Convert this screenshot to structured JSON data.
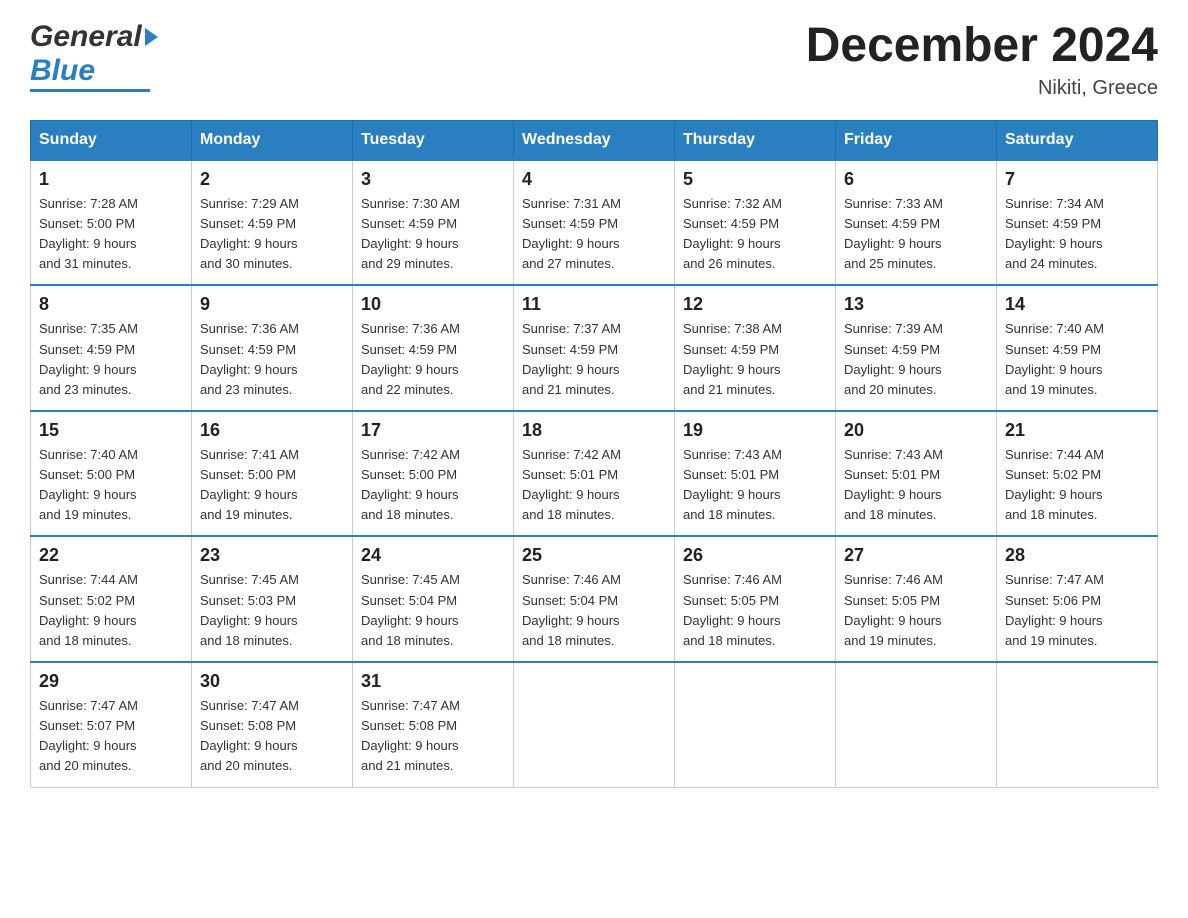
{
  "header": {
    "logo_general": "General",
    "logo_blue": "Blue",
    "month_title": "December 2024",
    "location": "Nikiti, Greece"
  },
  "days_of_week": [
    "Sunday",
    "Monday",
    "Tuesday",
    "Wednesday",
    "Thursday",
    "Friday",
    "Saturday"
  ],
  "weeks": [
    [
      {
        "day": "1",
        "sunrise": "7:28 AM",
        "sunset": "5:00 PM",
        "daylight": "9 hours and 31 minutes."
      },
      {
        "day": "2",
        "sunrise": "7:29 AM",
        "sunset": "4:59 PM",
        "daylight": "9 hours and 30 minutes."
      },
      {
        "day": "3",
        "sunrise": "7:30 AM",
        "sunset": "4:59 PM",
        "daylight": "9 hours and 29 minutes."
      },
      {
        "day": "4",
        "sunrise": "7:31 AM",
        "sunset": "4:59 PM",
        "daylight": "9 hours and 27 minutes."
      },
      {
        "day": "5",
        "sunrise": "7:32 AM",
        "sunset": "4:59 PM",
        "daylight": "9 hours and 26 minutes."
      },
      {
        "day": "6",
        "sunrise": "7:33 AM",
        "sunset": "4:59 PM",
        "daylight": "9 hours and 25 minutes."
      },
      {
        "day": "7",
        "sunrise": "7:34 AM",
        "sunset": "4:59 PM",
        "daylight": "9 hours and 24 minutes."
      }
    ],
    [
      {
        "day": "8",
        "sunrise": "7:35 AM",
        "sunset": "4:59 PM",
        "daylight": "9 hours and 23 minutes."
      },
      {
        "day": "9",
        "sunrise": "7:36 AM",
        "sunset": "4:59 PM",
        "daylight": "9 hours and 23 minutes."
      },
      {
        "day": "10",
        "sunrise": "7:36 AM",
        "sunset": "4:59 PM",
        "daylight": "9 hours and 22 minutes."
      },
      {
        "day": "11",
        "sunrise": "7:37 AM",
        "sunset": "4:59 PM",
        "daylight": "9 hours and 21 minutes."
      },
      {
        "day": "12",
        "sunrise": "7:38 AM",
        "sunset": "4:59 PM",
        "daylight": "9 hours and 21 minutes."
      },
      {
        "day": "13",
        "sunrise": "7:39 AM",
        "sunset": "4:59 PM",
        "daylight": "9 hours and 20 minutes."
      },
      {
        "day": "14",
        "sunrise": "7:40 AM",
        "sunset": "4:59 PM",
        "daylight": "9 hours and 19 minutes."
      }
    ],
    [
      {
        "day": "15",
        "sunrise": "7:40 AM",
        "sunset": "5:00 PM",
        "daylight": "9 hours and 19 minutes."
      },
      {
        "day": "16",
        "sunrise": "7:41 AM",
        "sunset": "5:00 PM",
        "daylight": "9 hours and 19 minutes."
      },
      {
        "day": "17",
        "sunrise": "7:42 AM",
        "sunset": "5:00 PM",
        "daylight": "9 hours and 18 minutes."
      },
      {
        "day": "18",
        "sunrise": "7:42 AM",
        "sunset": "5:01 PM",
        "daylight": "9 hours and 18 minutes."
      },
      {
        "day": "19",
        "sunrise": "7:43 AM",
        "sunset": "5:01 PM",
        "daylight": "9 hours and 18 minutes."
      },
      {
        "day": "20",
        "sunrise": "7:43 AM",
        "sunset": "5:01 PM",
        "daylight": "9 hours and 18 minutes."
      },
      {
        "day": "21",
        "sunrise": "7:44 AM",
        "sunset": "5:02 PM",
        "daylight": "9 hours and 18 minutes."
      }
    ],
    [
      {
        "day": "22",
        "sunrise": "7:44 AM",
        "sunset": "5:02 PM",
        "daylight": "9 hours and 18 minutes."
      },
      {
        "day": "23",
        "sunrise": "7:45 AM",
        "sunset": "5:03 PM",
        "daylight": "9 hours and 18 minutes."
      },
      {
        "day": "24",
        "sunrise": "7:45 AM",
        "sunset": "5:04 PM",
        "daylight": "9 hours and 18 minutes."
      },
      {
        "day": "25",
        "sunrise": "7:46 AM",
        "sunset": "5:04 PM",
        "daylight": "9 hours and 18 minutes."
      },
      {
        "day": "26",
        "sunrise": "7:46 AM",
        "sunset": "5:05 PM",
        "daylight": "9 hours and 18 minutes."
      },
      {
        "day": "27",
        "sunrise": "7:46 AM",
        "sunset": "5:05 PM",
        "daylight": "9 hours and 19 minutes."
      },
      {
        "day": "28",
        "sunrise": "7:47 AM",
        "sunset": "5:06 PM",
        "daylight": "9 hours and 19 minutes."
      }
    ],
    [
      {
        "day": "29",
        "sunrise": "7:47 AM",
        "sunset": "5:07 PM",
        "daylight": "9 hours and 20 minutes."
      },
      {
        "day": "30",
        "sunrise": "7:47 AM",
        "sunset": "5:08 PM",
        "daylight": "9 hours and 20 minutes."
      },
      {
        "day": "31",
        "sunrise": "7:47 AM",
        "sunset": "5:08 PM",
        "daylight": "9 hours and 21 minutes."
      },
      null,
      null,
      null,
      null
    ]
  ],
  "labels": {
    "sunrise": "Sunrise:",
    "sunset": "Sunset:",
    "daylight": "Daylight:"
  }
}
